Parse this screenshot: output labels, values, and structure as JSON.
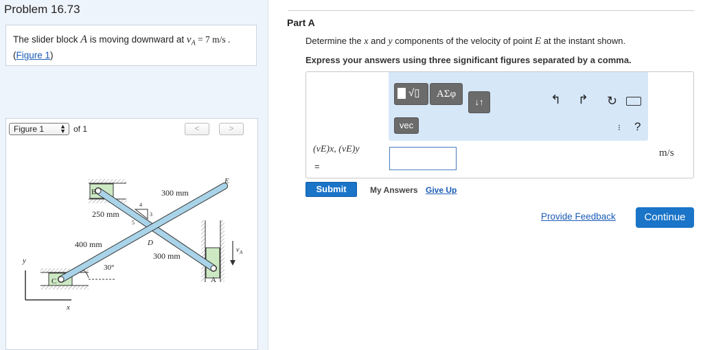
{
  "problem": {
    "title": "Problem 16.73",
    "statement_pre": "The slider block ",
    "statement_var": "A",
    "statement_mid": " is moving downward at ",
    "statement_sym": "v",
    "statement_sub": "A",
    "statement_eq": " = 7  m/s .",
    "figure_link": "Figure 1",
    "figure_paren_open": "(",
    "figure_paren_close": ")"
  },
  "figure_panel": {
    "select_value": "Figure 1",
    "of_label": "of 1",
    "prev_label": "<",
    "next_label": ">"
  },
  "diagram": {
    "label_B": "B",
    "label_C": "C",
    "label_A": "A",
    "label_D": "D",
    "label_E": "E",
    "dim_300_top": "300 mm",
    "dim_250": "250 mm",
    "dim_400": "400 mm",
    "dim_300_bottom": "300 mm",
    "angle": "30°",
    "slope_4": "4",
    "slope_3": "3",
    "slope_5": "5",
    "axis_y": "y",
    "axis_x": "x",
    "vel_v": "v",
    "vel_sub": "A"
  },
  "part": {
    "title": "Part A",
    "question_pre": "Determine the ",
    "q_x": "x",
    "question_and": " and ",
    "q_y": "y",
    "question_mid": " components of the velocity of point ",
    "q_E": "E",
    "question_post": " at the instant shown.",
    "instructions": "Express your answers using three significant figures separated by a comma."
  },
  "toolbar": {
    "templates_icon": "sqrt-template-icon",
    "greek_label": "ΑΣφ",
    "arrows_label": "↓↑",
    "vec_label": "vec",
    "undo_icon": "undo-icon",
    "redo_icon": "redo-icon",
    "reset_icon": "reset-icon",
    "keyboard_icon": "keyboard-icon",
    "help_label": "?"
  },
  "answer": {
    "label": "(vE)x, (vE)y",
    "eq": "=",
    "value": "",
    "unit": "m/s"
  },
  "actions": {
    "submit": "Submit",
    "my_answers": "My Answers",
    "give_up": "Give Up",
    "feedback": "Provide Feedback",
    "continue": "Continue"
  },
  "colors": {
    "accent": "#1a74c8",
    "link": "#1a5bb5",
    "toolbar_bg": "#d6e7f8",
    "rod_fill": "#a9d3e8",
    "block_fill": "#cde9c4"
  }
}
